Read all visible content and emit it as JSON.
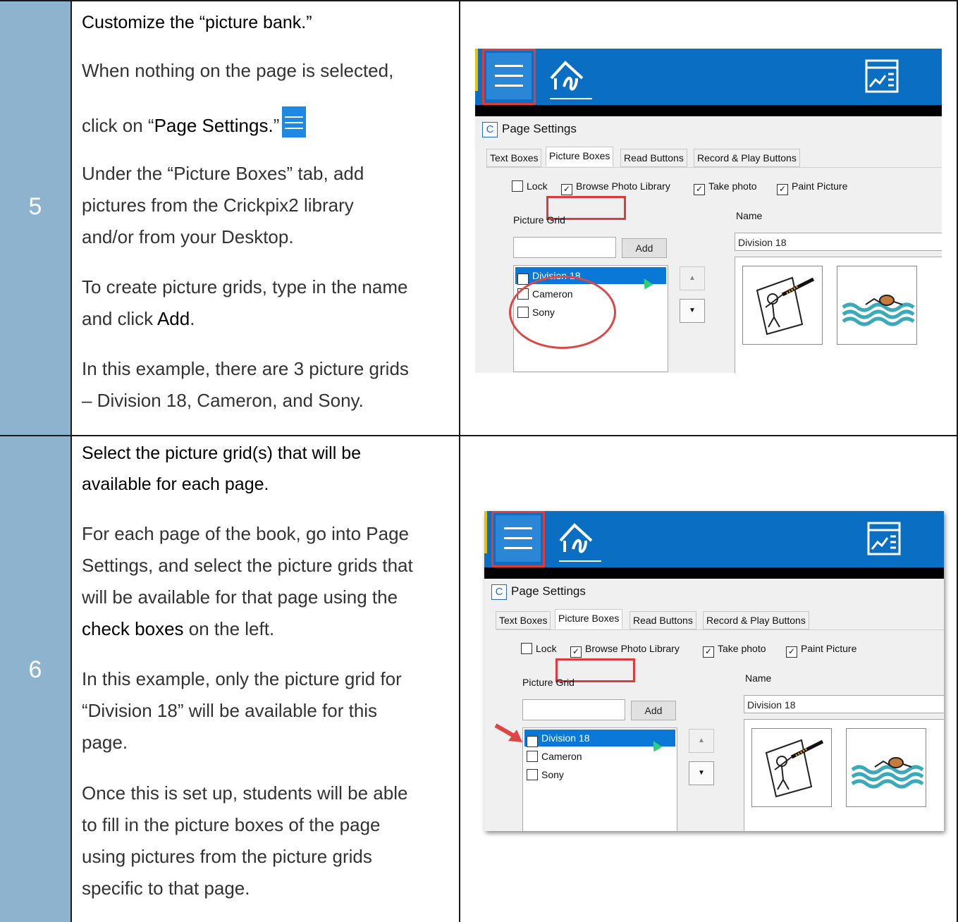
{
  "step5": {
    "number": "5",
    "heading": "Customize the “picture bank.”",
    "p1_line1": "When nothing on the page is selected,",
    "p1_pre": "click on “",
    "p1_bold": "Page Settings.",
    "p1_post": "”",
    "p2_line1": "Under the “Picture Boxes” tab, add",
    "p2_line2": "pictures from the Crickpix2 library",
    "p2_line3": "and/or from your Desktop.",
    "p3_line1": "To create picture grids, type in the name",
    "p3_pre": "and click ",
    "p3_bold": "Add",
    "p3_post": ".",
    "p4_line1": "In this example, there are 3 picture grids",
    "p4_line2": "– Division 18, Cameron, and Sony."
  },
  "step6": {
    "number": "6",
    "heading_line1": "Select the picture grid(s) that will be",
    "heading_line2": "available for each page.",
    "p1_line1": "For each page of the book, go into Page",
    "p1_line2": "Settings, and select the picture grids that",
    "p1_line3": "will be available for that page using the",
    "p1_bold": "check boxes",
    "p1_post": " on the left.",
    "p2_line1": "In this example, only the picture grid for",
    "p2_line2": "“Division 18” will be available for this",
    "p2_line3": "page.",
    "p3_line1": "Once this is set up, students will be able",
    "p3_line2": "to fill in the picture boxes of the page",
    "p3_line3": "using pictures from the picture grids",
    "p3_line4": "specific to that page."
  },
  "dialog": {
    "title": "Page Settings",
    "title_icon": "C",
    "tabs": [
      "Text Boxes",
      "Picture Boxes",
      "Read Buttons",
      "Record & Play Buttons"
    ],
    "options": [
      {
        "label": "Lock",
        "checked": false
      },
      {
        "label": "Browse Photo Library",
        "checked": true
      },
      {
        "label": "Take photo",
        "checked": true
      },
      {
        "label": "Paint Picture",
        "checked": true
      }
    ],
    "picture_grid_label": "Picture Grid",
    "add_label": "Add",
    "name_label": "Name",
    "name_value": "Division 18",
    "grids_step5": [
      {
        "label": "Division 18",
        "checked": true,
        "selected": true
      },
      {
        "label": "Cameron",
        "checked": false,
        "selected": false
      },
      {
        "label": "Sony",
        "checked": false,
        "selected": false
      }
    ],
    "grids_step6": [
      {
        "label": "Division 18",
        "checked": true,
        "selected": true
      },
      {
        "label": "Cameron",
        "checked": false,
        "selected": false
      },
      {
        "label": "Sony",
        "checked": false,
        "selected": false
      }
    ],
    "check_mark": "✓",
    "up_arrow": "▲",
    "down_arrow": "▼"
  },
  "colors": {
    "step_column": "#8db3cf",
    "toolbar": "#0a6fc2",
    "highlight": "#e03a3a",
    "selection": "#0a78d7"
  },
  "icons": {
    "menu": "hamburger-menu-icon",
    "pen": "pen-icon",
    "report": "report-icon",
    "picture1": "person-painting-icon",
    "picture2": "swimmer-icon"
  }
}
